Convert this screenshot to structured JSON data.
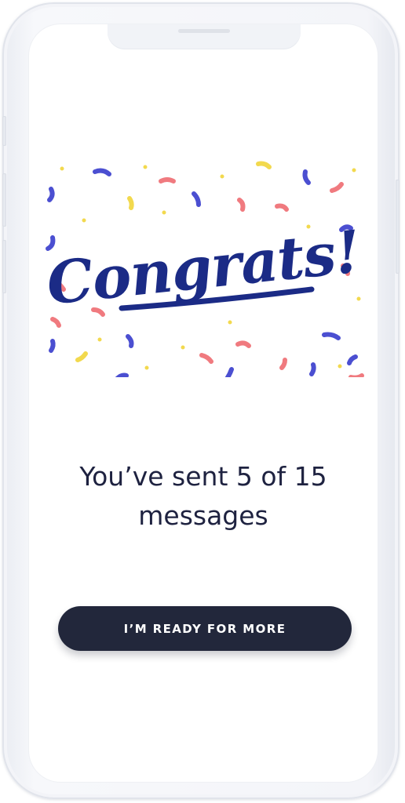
{
  "celebration": {
    "title": "Congrats!",
    "colors": {
      "lettering": "#1b2b86",
      "confetti_blue": "#4b4fd1",
      "confetti_pink": "#f07a7f",
      "confetti_yellow": "#f2d94e"
    },
    "icon": "confetti-icon"
  },
  "progress": {
    "line1": "You’ve sent 5 of 15",
    "line2": "messages",
    "sent": 5,
    "total": 15
  },
  "actions": {
    "primary_label": "I’M READY FOR MORE",
    "primary_color": "#22273b"
  }
}
